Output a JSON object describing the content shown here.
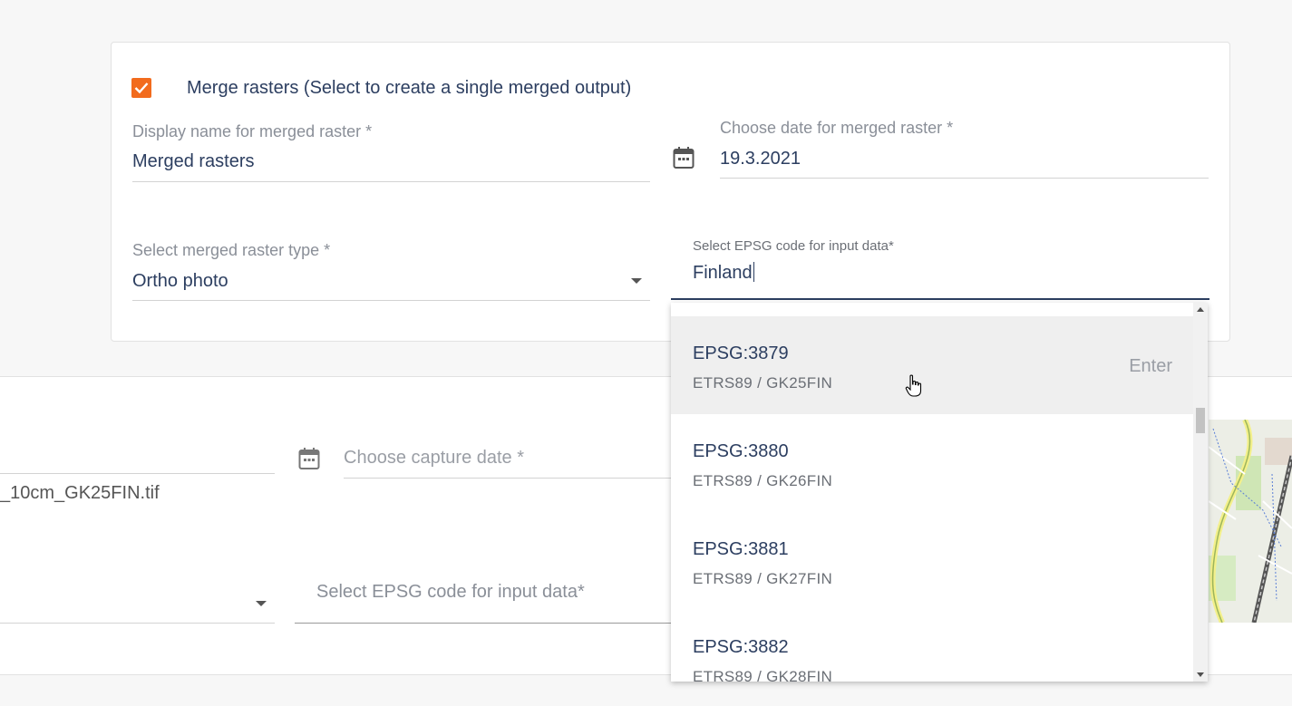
{
  "merge": {
    "checked": true,
    "label": "Merge rasters (Select to create a single merged output)"
  },
  "display_name": {
    "label": "Display name for merged raster *",
    "value": "Merged rasters"
  },
  "merged_date": {
    "label": "Choose date for merged raster *",
    "value": "19.3.2021"
  },
  "raster_type": {
    "label": "Select merged raster type *",
    "value": "Ortho photo"
  },
  "epsg_search": {
    "label": "Select EPSG code for input data*",
    "value": "Finland"
  },
  "epsg_options": [
    {
      "code": "EPSG:3879",
      "name": "ETRS89 / GK25FIN",
      "hint": "Enter"
    },
    {
      "code": "EPSG:3880",
      "name": "ETRS89 / GK26FIN",
      "hint": ""
    },
    {
      "code": "EPSG:3881",
      "name": "ETRS89 / GK27FIN",
      "hint": ""
    },
    {
      "code": "EPSG:3882",
      "name": "ETRS89 / GK28FIN",
      "hint": ""
    }
  ],
  "file_row": {
    "filename": "_10cm_GK25FIN.tif",
    "capture_date_placeholder": "Choose capture date *",
    "epsg_placeholder": "Select EPSG code for input data*"
  },
  "colors": {
    "accent_orange": "#f26b1d",
    "text_navy": "#2c3e60",
    "label_gray": "#8a8f98"
  }
}
